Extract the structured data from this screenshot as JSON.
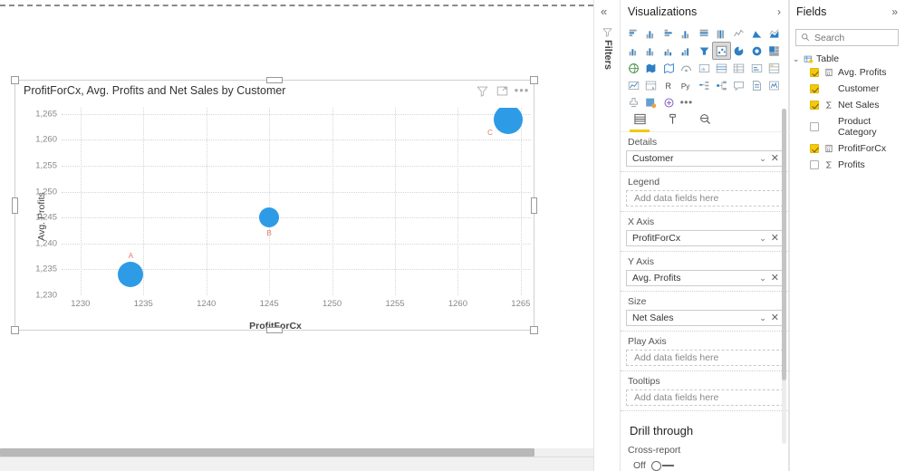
{
  "canvas": {
    "visual": {
      "title": "ProfitForCx, Avg. Profits and Net Sales by Customer",
      "icons": [
        {
          "name": "filter-icon",
          "label": "Filters"
        },
        {
          "name": "focus-mode-icon",
          "label": "Focus mode"
        },
        {
          "name": "more-options-icon",
          "label": "More options"
        }
      ]
    }
  },
  "chart_data": {
    "type": "scatter",
    "title": "ProfitForCx, Avg. Profits and Net Sales by Customer",
    "xlabel": "ProfitForCx",
    "ylabel": "Avg. Profits",
    "xlim": [
      1228.5,
      1265.8
    ],
    "ylim": [
      1230,
      1266.2
    ],
    "xticks": [
      "1230",
      "1235",
      "1240",
      "1245",
      "1250",
      "1255",
      "1260",
      "1265"
    ],
    "xtick_values": [
      1230,
      1235,
      1240,
      1245,
      1250,
      1255,
      1260,
      1265
    ],
    "yticks": [
      "1,230",
      "1,235",
      "1,240",
      "1,245",
      "1,250",
      "1,255",
      "1,260",
      "1,265"
    ],
    "ytick_values": [
      1230,
      1235,
      1240,
      1245,
      1250,
      1255,
      1260,
      1265
    ],
    "grid": true,
    "legend": "none",
    "marker_color": "#2e9be6",
    "label_color": "#e8766e",
    "size_field": "Net Sales",
    "points": [
      {
        "label": "A",
        "x": 1234,
        "y": 1234,
        "r": 14,
        "label_pos": "above"
      },
      {
        "label": "B",
        "x": 1245,
        "y": 1245,
        "r": 11,
        "label_pos": "below"
      },
      {
        "label": "C",
        "x": 1264,
        "y": 1264,
        "r": 16,
        "label_pos": "left"
      }
    ]
  },
  "filters_rail": {
    "collapse_icon": "«",
    "label": "Filters"
  },
  "visualizations": {
    "title": "Visualizations",
    "chevron": "›",
    "selected_type": "scatter-chart",
    "types": [
      "stacked-bar-chart",
      "stacked-column-chart",
      "clustered-bar-chart",
      "clustered-column-chart",
      "100-percent-stacked-bar-chart",
      "100-percent-stacked-column-chart",
      "line-chart",
      "area-chart",
      "stacked-area-chart",
      "line-and-stacked-column-chart",
      "line-and-clustered-column-chart",
      "ribbon-chart",
      "waterfall-chart",
      "funnel-chart",
      "scatter-chart",
      "pie-chart",
      "donut-chart",
      "treemap",
      "map",
      "filled-map",
      "shape-map",
      "arcgis-map",
      "key-influencers",
      "table",
      "matrix",
      "card",
      "multi-row-card",
      "kpi",
      "slicer",
      "r-script-visual",
      "python-visual",
      "decomposition-tree",
      "key-influencer-tree",
      "q-and-a",
      "paginated-report",
      "smart-narrative",
      "get-more-visuals",
      "power-apps",
      "power-automate",
      "more-options"
    ],
    "well_tabs": [
      {
        "name": "fields-tab",
        "active": true
      },
      {
        "name": "format-tab",
        "active": false
      },
      {
        "name": "analytics-tab",
        "active": false
      }
    ],
    "wells": [
      {
        "label": "Details",
        "value": "Customer",
        "empty": false
      },
      {
        "label": "Legend",
        "value": "Add data fields here",
        "empty": true
      },
      {
        "label": "X Axis",
        "value": "ProfitForCx",
        "empty": false
      },
      {
        "label": "Y Axis",
        "value": "Avg. Profits",
        "empty": false
      },
      {
        "label": "Size",
        "value": "Net Sales",
        "empty": false
      },
      {
        "label": "Play Axis",
        "value": "Add data fields here",
        "empty": true
      },
      {
        "label": "Tooltips",
        "value": "Add data fields here",
        "empty": true
      }
    ],
    "drill_through": {
      "title": "Drill through",
      "cross_report_label": "Cross-report",
      "toggle_state": "Off"
    }
  },
  "fields": {
    "title": "Fields",
    "chevron": "»",
    "search_placeholder": "Search",
    "search_value": "",
    "table_name": "Table",
    "items": [
      {
        "name": "Avg. Profits",
        "checked": true,
        "icon": "measure-icon"
      },
      {
        "name": "Customer",
        "checked": true,
        "icon": "none"
      },
      {
        "name": "Net Sales",
        "checked": true,
        "icon": "sigma-icon"
      },
      {
        "name": "Product Category",
        "checked": false,
        "icon": "none"
      },
      {
        "name": "ProfitForCx",
        "checked": true,
        "icon": "measure-icon"
      },
      {
        "name": "Profits",
        "checked": false,
        "icon": "sigma-icon"
      }
    ]
  },
  "colors": {
    "accent": "#f2c811",
    "marker": "#2e9be6",
    "label": "#e8766e"
  }
}
